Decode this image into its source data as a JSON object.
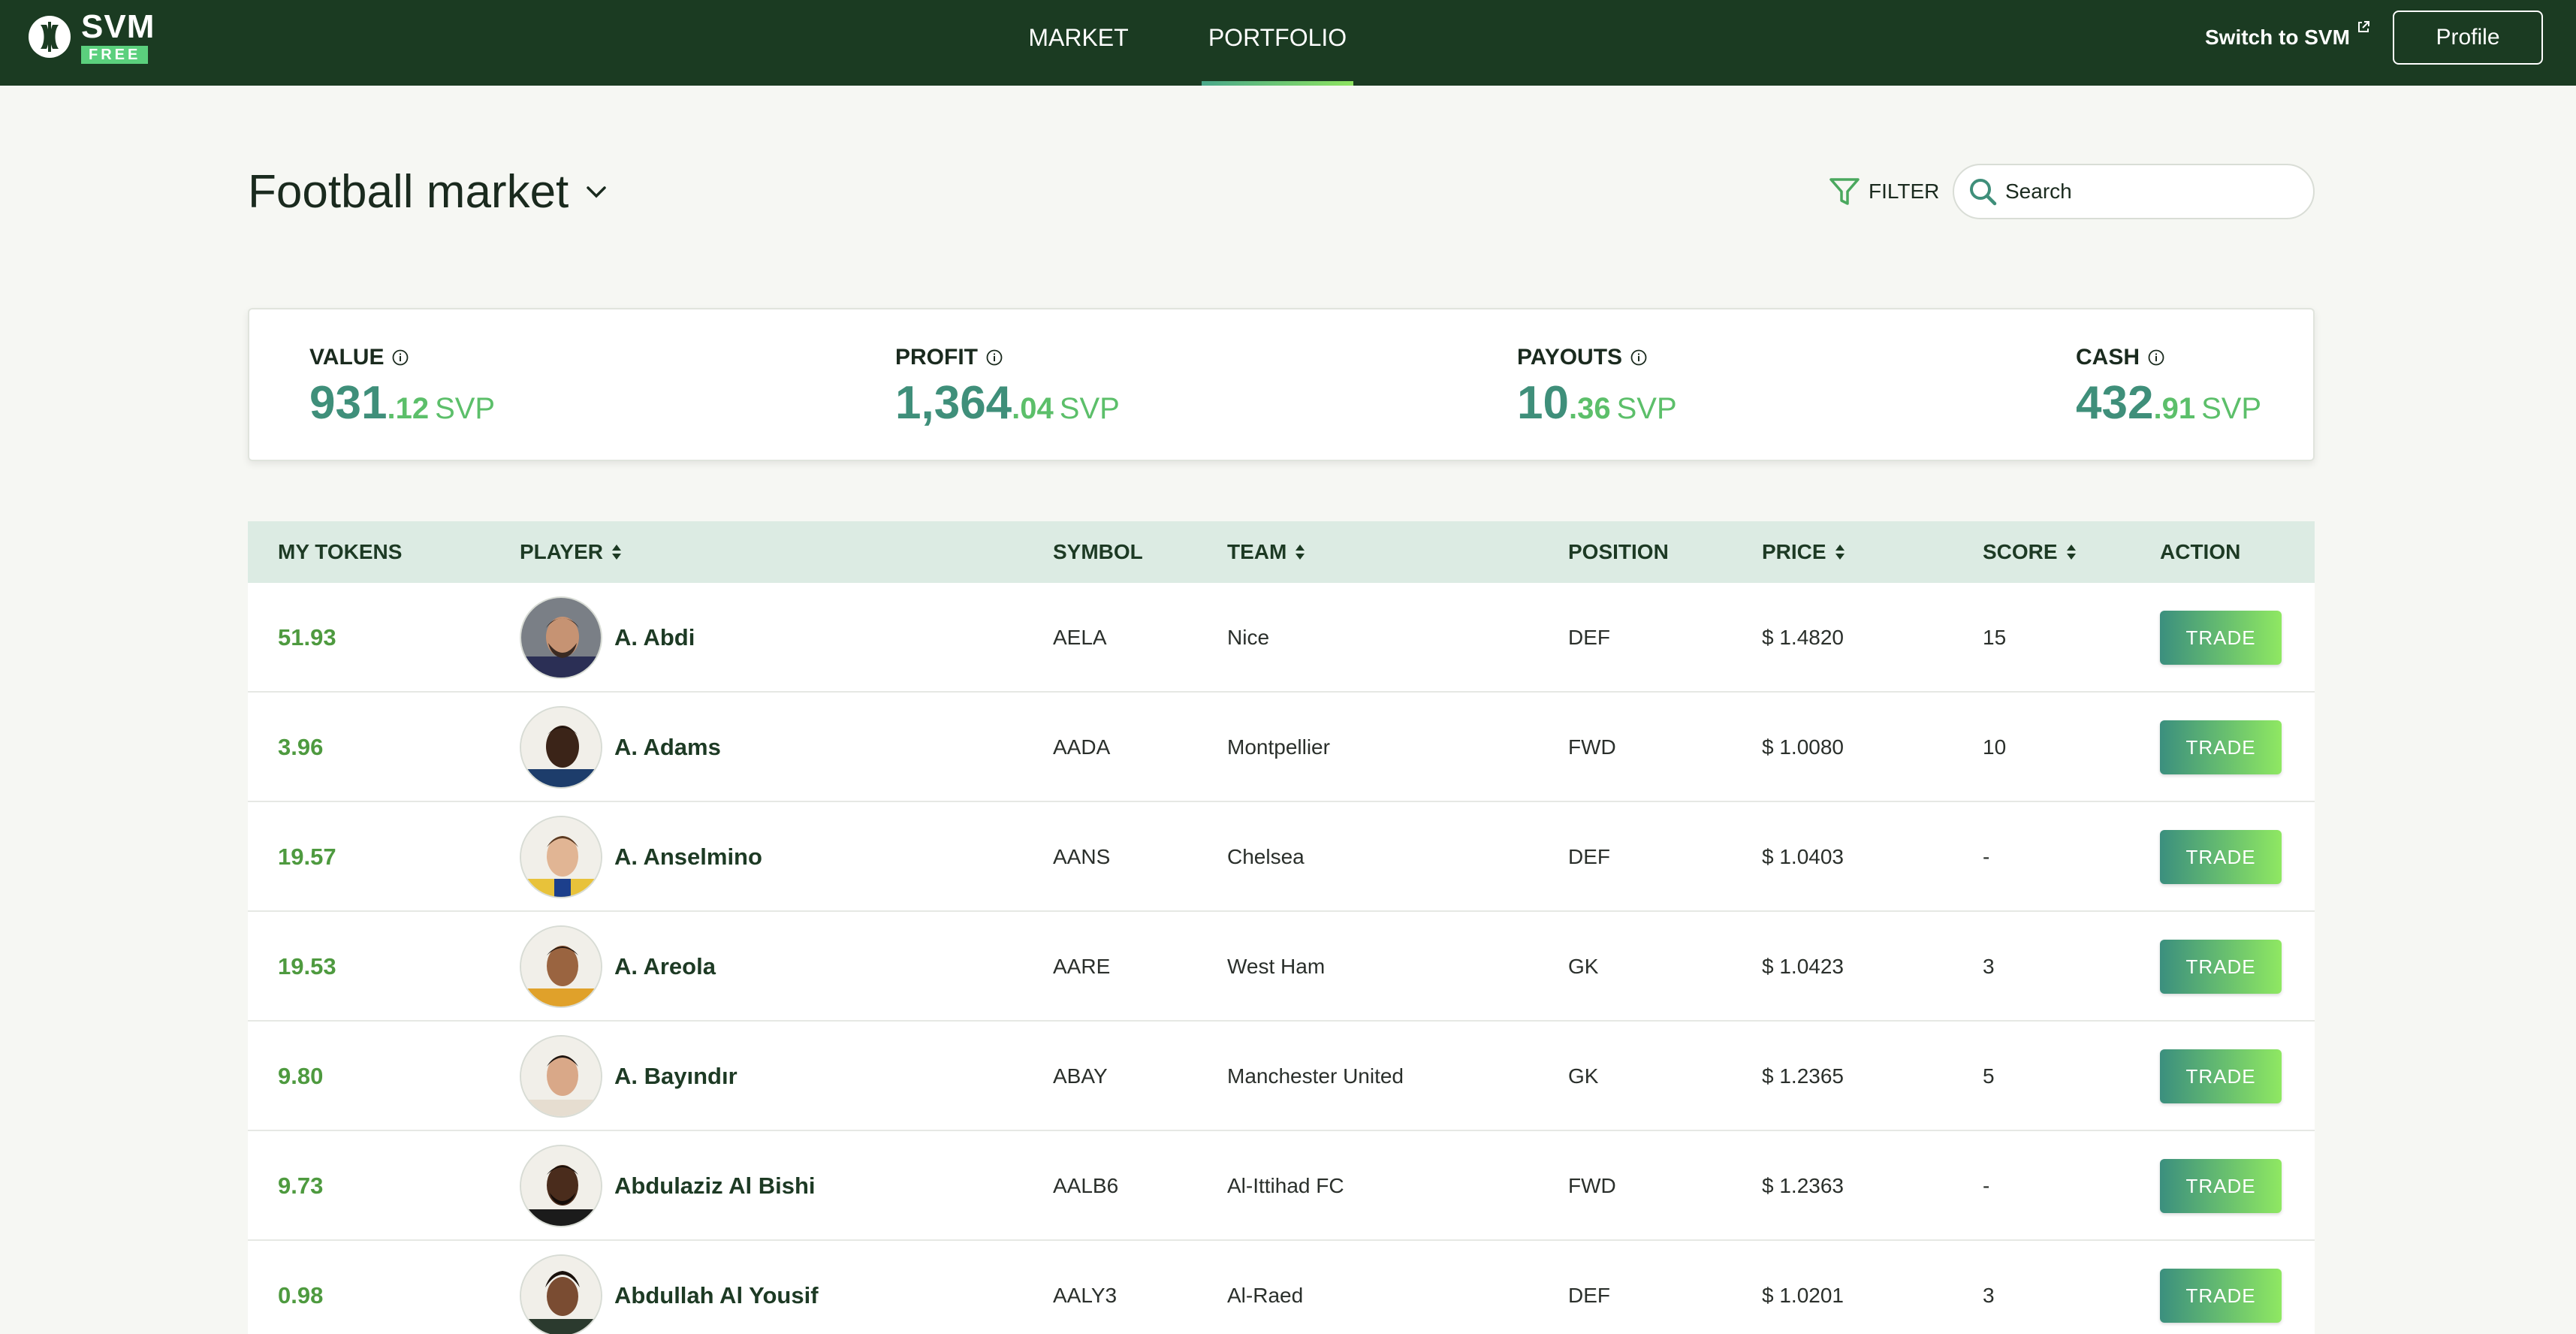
{
  "header": {
    "logo_text": "SVM",
    "logo_badge": "FREE",
    "tabs": [
      {
        "label": "MARKET",
        "active": false
      },
      {
        "label": "PORTFOLIO",
        "active": true
      }
    ],
    "switch_link": "Switch to SVM",
    "profile_label": "Profile"
  },
  "page": {
    "title": "Football market",
    "filter_label": "FILTER",
    "search_placeholder": "Search"
  },
  "summary": {
    "value": {
      "label": "VALUE",
      "int": "931",
      "dec": ".12",
      "unit": "SVP"
    },
    "profit": {
      "label": "PROFIT",
      "int": "1,364",
      "dec": ".04",
      "unit": "SVP"
    },
    "payouts": {
      "label": "PAYOUTS",
      "int": "10",
      "dec": ".36",
      "unit": "SVP"
    },
    "cash": {
      "label": "CASH",
      "int": "432",
      "dec": ".91",
      "unit": "SVP"
    }
  },
  "table": {
    "columns": {
      "tokens": "MY TOKENS",
      "player": "PLAYER",
      "symbol": "SYMBOL",
      "team": "TEAM",
      "position": "POSITION",
      "price": "PRICE",
      "score": "SCORE",
      "action": "ACTION"
    },
    "rows": [
      {
        "tokens": "51.93",
        "player": "A. Abdi",
        "symbol": "AELA",
        "team": "Nice",
        "position": "DEF",
        "price": "$ 1.4820",
        "score": "15",
        "action": "TRADE"
      },
      {
        "tokens": "3.96",
        "player": "A. Adams",
        "symbol": "AADA",
        "team": "Montpellier",
        "position": "FWD",
        "price": "$ 1.0080",
        "score": "10",
        "action": "TRADE"
      },
      {
        "tokens": "19.57",
        "player": "A. Anselmino",
        "symbol": "AANS",
        "team": "Chelsea",
        "position": "DEF",
        "price": "$ 1.0403",
        "score": "-",
        "action": "TRADE"
      },
      {
        "tokens": "19.53",
        "player": "A. Areola",
        "symbol": "AARE",
        "team": "West Ham",
        "position": "GK",
        "price": "$ 1.0423",
        "score": "3",
        "action": "TRADE"
      },
      {
        "tokens": "9.80",
        "player": "A. Bayındır",
        "symbol": "ABAY",
        "team": "Manchester United",
        "position": "GK",
        "price": "$ 1.2365",
        "score": "5",
        "action": "TRADE"
      },
      {
        "tokens": "9.73",
        "player": "Abdulaziz Al Bishi",
        "symbol": "AALB6",
        "team": "Al-Ittihad FC",
        "position": "FWD",
        "price": "$ 1.2363",
        "score": "-",
        "action": "TRADE"
      },
      {
        "tokens": "0.98",
        "player": "Abdullah Al Yousif",
        "symbol": "AALY3",
        "team": "Al-Raed",
        "position": "DEF",
        "price": "$ 1.0201",
        "score": "3",
        "action": "TRADE"
      }
    ]
  },
  "colors": {
    "topbar": "#1b3b22",
    "accent_green": "#5cbf6a",
    "value_teal": "#3f8f7a",
    "table_header": "#dcebe3"
  },
  "icons": {
    "logo": "svm-logo-icon",
    "external": "external-link-icon",
    "chevron": "chevron-down-icon",
    "filter": "filter-icon",
    "search": "search-icon",
    "info": "info-icon",
    "sort": "sort-icon"
  }
}
